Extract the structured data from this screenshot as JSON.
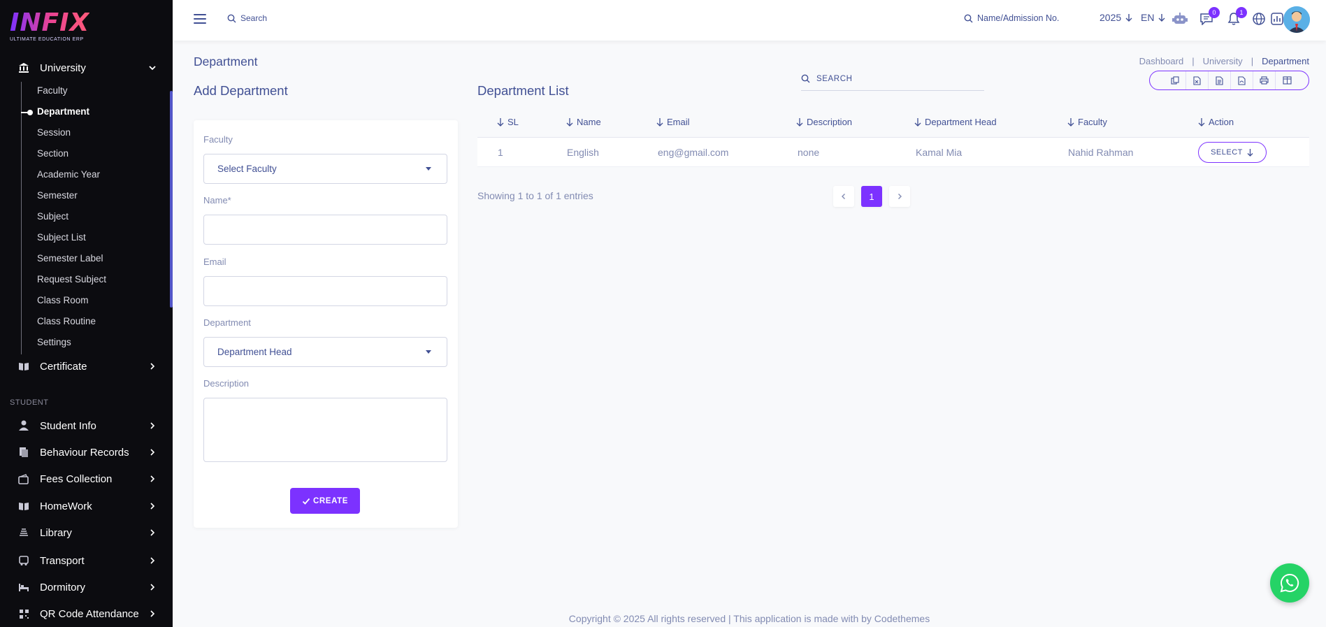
{
  "app": {
    "brand": "INFIX",
    "tagline": "ULTIMATE EDUCATION ERP"
  },
  "sidebar": {
    "university": {
      "label": "University",
      "icon": "university-icon"
    },
    "sub_items": [
      {
        "label": "Faculty"
      },
      {
        "label": "Department"
      },
      {
        "label": "Session"
      },
      {
        "label": "Section"
      },
      {
        "label": "Academic Year"
      },
      {
        "label": "Semester"
      },
      {
        "label": "Subject"
      },
      {
        "label": "Subject List"
      },
      {
        "label": "Semester Label"
      },
      {
        "label": "Request Subject"
      },
      {
        "label": "Class Room"
      },
      {
        "label": "Class Routine"
      },
      {
        "label": "Settings"
      }
    ],
    "certificate": {
      "label": "Certificate"
    },
    "section_student": "STUDENT",
    "student_items": [
      {
        "label": "Student Info"
      },
      {
        "label": "Behaviour Records"
      },
      {
        "label": "Fees Collection"
      },
      {
        "label": "HomeWork"
      },
      {
        "label": "Library"
      },
      {
        "label": "Transport"
      },
      {
        "label": "Dormitory"
      },
      {
        "label": "QR Code Attendance"
      }
    ]
  },
  "header": {
    "search_label": "Search",
    "admission_search": "Name/Admission No.",
    "year": "2025",
    "lang": "EN",
    "chat_count": "0",
    "notification_count": "1"
  },
  "page": {
    "title": "Department",
    "breadcrumb": [
      "Dashboard",
      "University",
      "Department"
    ]
  },
  "form": {
    "title": "Add Department",
    "faculty_label": "Faculty",
    "faculty_placeholder": "Select Faculty",
    "name_label": "Name*",
    "email_label": "Email",
    "department_label": "Department",
    "department_placeholder": "Department Head",
    "description_label": "Description",
    "create_button": "CREATE"
  },
  "list": {
    "title": "Department List",
    "search_label": "SEARCH",
    "columns": [
      "SL",
      "Name",
      "Email",
      "Description",
      "Department Head",
      "Faculty",
      "Action"
    ],
    "rows": [
      {
        "sl": "1",
        "name": "English",
        "email": "eng@gmail.com",
        "description": "none",
        "head": "Kamal Mia",
        "faculty": "Nahid Rahman",
        "action": "SELECT"
      }
    ],
    "showing": "Showing 1 to 1 of 1 entries",
    "current_page": "1"
  },
  "footer": {
    "text": "Copyright © 2025 All rights reserved | This application is made with by Codethemes"
  },
  "colors": {
    "accent": "#7c32ff",
    "text": "#415094",
    "muted": "#828bb2",
    "sidebar_bg": "#0c0c10",
    "whatsapp": "#25d366"
  }
}
